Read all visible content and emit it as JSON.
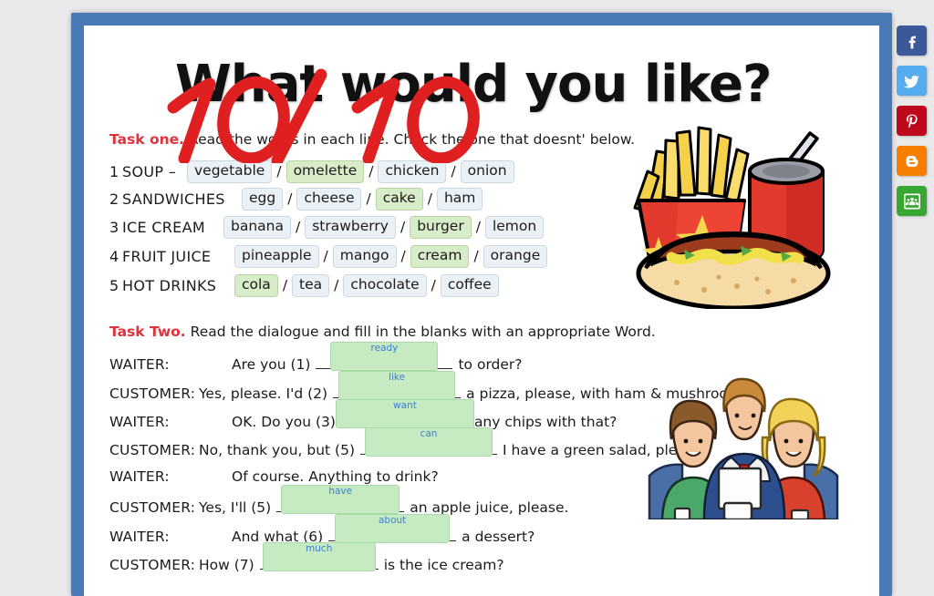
{
  "worksheet": {
    "title": "What would you like?",
    "grade_mark": "10/10",
    "grade_color": "#e02020",
    "border_color": "#4a7ab5",
    "page_background": "#ffffff",
    "canvas_background": "#e9e9e9"
  },
  "task_one": {
    "label": "Task one.",
    "instructions": "Read the words in each line. Check the one that doesnt' below.",
    "rows": [
      {
        "number": "1",
        "category": "SOUP –",
        "options": [
          {
            "word": "vegetable",
            "selected": false
          },
          {
            "word": "omelette",
            "selected": true
          },
          {
            "word": "chicken",
            "selected": false
          },
          {
            "word": "onion",
            "selected": false
          }
        ]
      },
      {
        "number": "2",
        "category": "SANDWICHES",
        "options": [
          {
            "word": "egg",
            "selected": false
          },
          {
            "word": "cheese",
            "selected": false
          },
          {
            "word": "cake",
            "selected": true
          },
          {
            "word": "ham",
            "selected": false
          }
        ]
      },
      {
        "number": "3",
        "category": "ICE CREAM",
        "options": [
          {
            "word": "banana",
            "selected": false
          },
          {
            "word": "strawberry",
            "selected": false
          },
          {
            "word": "burger",
            "selected": true
          },
          {
            "word": "lemon",
            "selected": false
          }
        ]
      },
      {
        "number": "4",
        "category": "FRUIT JUICE",
        "options": [
          {
            "word": "pineapple",
            "selected": false
          },
          {
            "word": "mango",
            "selected": false
          },
          {
            "word": "cream",
            "selected": true
          },
          {
            "word": "orange",
            "selected": false
          }
        ]
      },
      {
        "number": "5",
        "category": "HOT DRINKS",
        "options": [
          {
            "word": "cola",
            "selected": true
          },
          {
            "word": "tea",
            "selected": false
          },
          {
            "word": "chocolate",
            "selected": false
          },
          {
            "word": "coffee",
            "selected": false
          }
        ]
      }
    ],
    "separator": "/"
  },
  "task_two": {
    "label": "Task Two.",
    "instructions": "Read the dialogue and fill in the blanks with an appropriate Word.",
    "dialogue": [
      {
        "speaker": "WAITER:",
        "before": "Are you (1)",
        "answer": "ready",
        "after": "to order?"
      },
      {
        "speaker": "CUSTOMER:",
        "before": "Yes, please.  I'd (2)",
        "answer": "like",
        "after": "a pizza, please, with ham & mushrooms."
      },
      {
        "speaker": "WAITER:",
        "before": "OK.  Do you (3)",
        "answer": "want",
        "after": "any chips with that?"
      },
      {
        "speaker": "CUSTOMER:",
        "before": "No, thank you, but (5)",
        "answer": "can",
        "after": "I have a green salad, please?"
      },
      {
        "speaker": "WAITER:",
        "before": "Of course.  Anything to drink?",
        "answer": "",
        "after": ""
      },
      {
        "speaker": "CUSTOMER:",
        "before": "Yes, I'll (5)",
        "answer": "have",
        "after": "an apple juice, please."
      },
      {
        "speaker": "WAITER:",
        "before": "And what (6)",
        "answer": "about",
        "after": "a dessert?"
      },
      {
        "speaker": "CUSTOMER:",
        "before": "How (7)",
        "answer": "much",
        "after": "is the ice cream?"
      }
    ],
    "answer_box_fill": "#c6ebc3",
    "answer_text_color": "#3f7fd0"
  },
  "illustrations": [
    {
      "name": "fast-food-clipart",
      "description": "French fries in red carton with yellow stars, red soda can with straw, hot dog with mustard"
    },
    {
      "name": "waiter-and-customers-clipart",
      "description": "Waiter in blue suit with red tie taking an order from two seated women"
    }
  ],
  "share_rail": {
    "buttons": [
      {
        "name": "facebook",
        "label": "f",
        "color": "#3b5998"
      },
      {
        "name": "twitter",
        "label": "t",
        "color": "#55acee"
      },
      {
        "name": "pinterest",
        "label": "p",
        "color": "#bd081c"
      },
      {
        "name": "blogger",
        "label": "b",
        "color": "#f57d00"
      },
      {
        "name": "google-classroom",
        "label": "c",
        "color": "#38a632"
      }
    ]
  }
}
